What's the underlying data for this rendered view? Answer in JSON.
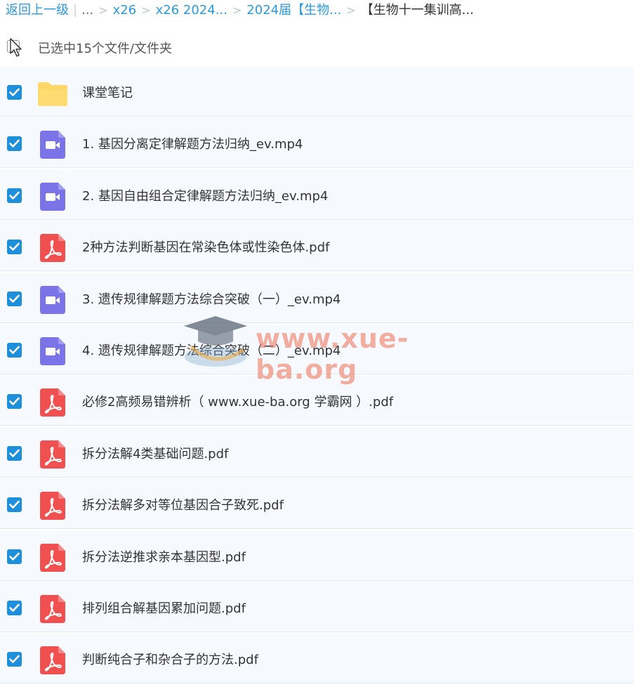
{
  "breadcrumb": {
    "back_label": "返回上一级",
    "ellipsis": "...",
    "crumbs": [
      "x26",
      "x26 2024...",
      "2024届【生物..."
    ],
    "current": "【生物十一集训高..."
  },
  "selection": {
    "text": "已选中15个文件/文件夹"
  },
  "watermark": {
    "text": "www.xue-ba.org"
  },
  "colors": {
    "accent": "#1e8fdb",
    "link": "#2a9be0",
    "video_icon": "#7b74e8",
    "pdf_icon": "#f0504f",
    "folder_icon": "#ffd766"
  },
  "files": [
    {
      "name": "课堂笔记",
      "type": "folder",
      "icon": "folder-icon",
      "checked": true
    },
    {
      "name": "1. 基因分离定律解题方法归纳_ev.mp4",
      "type": "video",
      "icon": "video-file-icon",
      "checked": true
    },
    {
      "name": "2. 基因自由组合定律解题方法归纳_ev.mp4",
      "type": "video",
      "icon": "video-file-icon",
      "checked": true
    },
    {
      "name": "2种方法判断基因在常染色体或性染色体.pdf",
      "type": "pdf",
      "icon": "pdf-file-icon",
      "checked": true
    },
    {
      "name": "3. 遗传规律解题方法综合突破（一）_ev.mp4",
      "type": "video",
      "icon": "video-file-icon",
      "checked": true
    },
    {
      "name": "4. 遗传规律解题方法综合突破（二）_ev.mp4",
      "type": "video",
      "icon": "video-file-icon",
      "checked": true
    },
    {
      "name": "必修2高频易错辨析（ www.xue-ba.org 学霸网 ）.pdf",
      "type": "pdf",
      "icon": "pdf-file-icon",
      "checked": true
    },
    {
      "name": "拆分法解4类基础问题.pdf",
      "type": "pdf",
      "icon": "pdf-file-icon",
      "checked": true
    },
    {
      "name": "拆分法解多对等位基因合子致死.pdf",
      "type": "pdf",
      "icon": "pdf-file-icon",
      "checked": true
    },
    {
      "name": "拆分法逆推求亲本基因型.pdf",
      "type": "pdf",
      "icon": "pdf-file-icon",
      "checked": true
    },
    {
      "name": "排列组合解基因累加问题.pdf",
      "type": "pdf",
      "icon": "pdf-file-icon",
      "checked": true
    },
    {
      "name": "判断纯合子和杂合子的方法.pdf",
      "type": "pdf",
      "icon": "pdf-file-icon",
      "checked": true
    }
  ]
}
